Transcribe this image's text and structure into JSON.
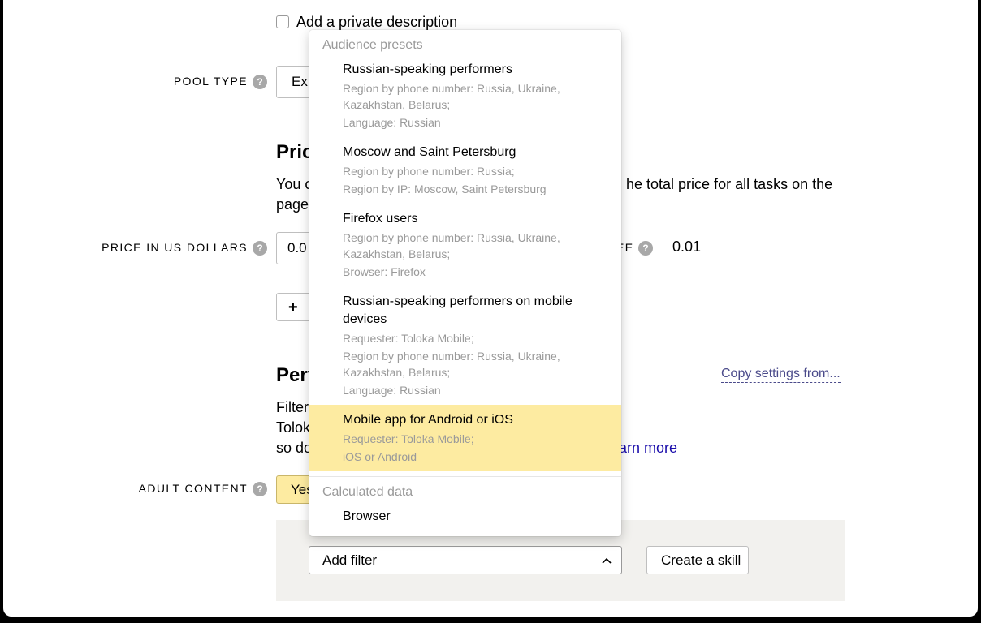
{
  "private_description": {
    "label": "Add a private description",
    "checked": false
  },
  "pool_type": {
    "label": "POOL TYPE",
    "value": "Ex"
  },
  "price": {
    "heading": "Pric",
    "desc_line1_left": "You c",
    "desc_line1_right": "he total price for all tasks on the",
    "desc_line2": "page",
    "label": "PRICE IN US DOLLARS",
    "value": "0.0",
    "fee_label": "EE",
    "fee_value": "0.01",
    "add_button": "+ "
  },
  "performers": {
    "heading": "Perf",
    "copy_link": "Copy settings from...",
    "desc_line1": "Filter",
    "desc_line2": "Tolok",
    "desc_line3": "so do",
    "learn_more": "arn more"
  },
  "adult_content": {
    "label": "ADULT CONTENT",
    "value": "Yes"
  },
  "help_glyph": "?",
  "filter_select": {
    "value": "Add filter",
    "icon": "chevron-up-icon"
  },
  "create_skill_button": "Create a skill",
  "dropdown": {
    "groups": [
      {
        "title": "Audience presets",
        "items": [
          {
            "title": "Russian-speaking performers",
            "lines": [
              "Region by phone number: Russia, Ukraine, Kazakhstan, Belarus;",
              "Language: Russian"
            ]
          },
          {
            "title": "Moscow and Saint Petersburg",
            "lines": [
              "Region by phone number: Russia;",
              "Region by IP: Moscow, Saint Petersburg"
            ]
          },
          {
            "title": "Firefox users",
            "lines": [
              "Region by phone number: Russia, Ukraine, Kazakhstan, Belarus;",
              "Browser: Firefox"
            ]
          },
          {
            "title": "Russian-speaking performers on mobile devices",
            "lines": [
              "Requester: Toloka Mobile;",
              "Region by phone number: Russia, Ukraine, Kazakhstan, Belarus;",
              "Language: Russian"
            ]
          },
          {
            "title": "Mobile app for Android or iOS",
            "lines": [
              "Requester: Toloka Mobile;",
              "iOS or Android"
            ],
            "selected": true
          }
        ]
      },
      {
        "title": "Calculated data",
        "items": [
          {
            "title": "Browser",
            "lines": []
          }
        ]
      }
    ]
  },
  "colors": {
    "selected_bg": "#fdeba1",
    "link": "#1a0dab",
    "help_bg": "#a8a8a8",
    "filter_area_bg": "#f2f1ee"
  }
}
